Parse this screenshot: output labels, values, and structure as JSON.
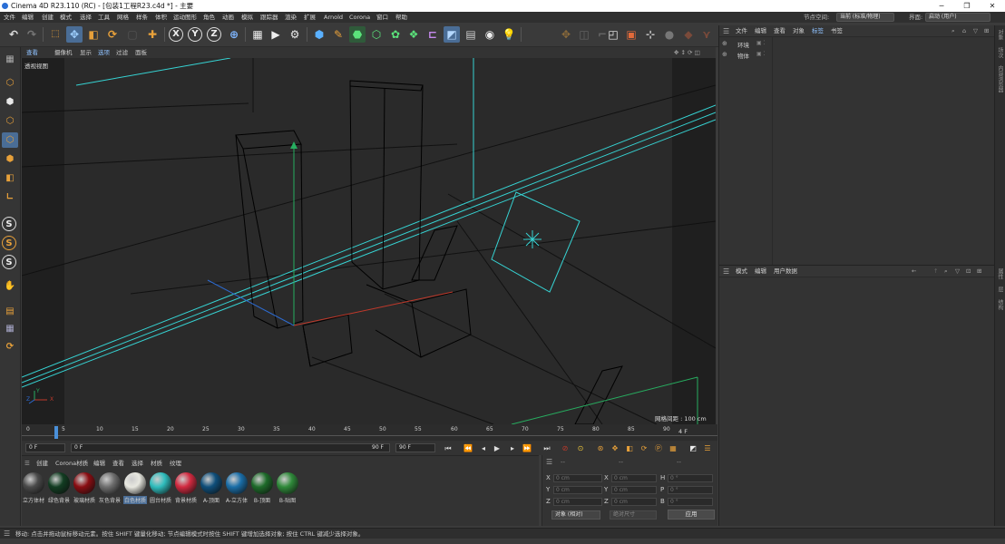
{
  "window": {
    "title": "Cinema 4D R23.110 (RC) - [包装1工程R23.c4d *] - 主要"
  },
  "menu": {
    "items": [
      "文件",
      "编辑",
      "创建",
      "模式",
      "选择",
      "工具",
      "网格",
      "样条",
      "体积",
      "运动图形",
      "角色",
      "动画",
      "模拟",
      "跟踪器",
      "渲染",
      "扩展",
      "Arnold",
      "Corona",
      "窗口",
      "帮助"
    ],
    "node_space_label": "节点空间:",
    "node_space_value": "当前 (标准/物理)",
    "layout_label": "界面:",
    "layout_value": "启动 (用户)"
  },
  "viewport": {
    "menu": [
      "查看",
      "摄像机",
      "显示",
      "选项",
      "过滤",
      "面板"
    ],
    "view_name": "透视视图",
    "grid_spacing": "网格间距 : 100 cm",
    "axis_labels": {
      "x": "X",
      "y": "Y",
      "z": "Z"
    }
  },
  "timeline": {
    "ticks": [
      "0",
      "5",
      "10",
      "15",
      "20",
      "25",
      "30",
      "35",
      "40",
      "45",
      "50",
      "55",
      "60",
      "65",
      "70",
      "75",
      "80",
      "85",
      "90"
    ],
    "current_frame": "4 F",
    "start_field": "0 F",
    "current_field": "0 F",
    "end_field": "90 F",
    "end_field2": "90 F"
  },
  "materials": {
    "menu": [
      "创建",
      "Corona材质",
      "编辑",
      "查看",
      "选择",
      "材质",
      "纹理"
    ],
    "items": [
      {
        "label": "立方体材",
        "color": "#4a4a4a"
      },
      {
        "label": "绿色背景",
        "color": "#123d22"
      },
      {
        "label": "玻璃材质",
        "color": "#8a0d12"
      },
      {
        "label": "灰色背景",
        "color": "#6e6e6e"
      },
      {
        "label": "白色材质",
        "color": "#e8e8e0"
      },
      {
        "label": "圆台材质",
        "color": "#2fbdbd"
      },
      {
        "label": "背景材质",
        "color": "#d22a40"
      },
      {
        "label": "A-顶面",
        "color": "#0e4e7a"
      },
      {
        "label": "A-立方体",
        "color": "#1a6ea8"
      },
      {
        "label": "B-顶面",
        "color": "#1e6b2a"
      },
      {
        "label": "B-贴图",
        "color": "#2f8a3a"
      }
    ]
  },
  "coordinates": {
    "header": [
      "--",
      "--",
      "--"
    ],
    "rows": [
      {
        "a": "X",
        "av": "0 cm",
        "b": "X",
        "bv": "0 cm",
        "c": "H",
        "cv": "0 °"
      },
      {
        "a": "Y",
        "av": "0 cm",
        "b": "Y",
        "bv": "0 cm",
        "c": "P",
        "cv": "0 °"
      },
      {
        "a": "Z",
        "av": "0 cm",
        "b": "Z",
        "bv": "0 cm",
        "c": "B",
        "cv": "0 °"
      }
    ],
    "mode_select": "对象 (相对)",
    "size_select": "绝对尺寸",
    "apply": "应用"
  },
  "objects": {
    "menu": [
      "文件",
      "编辑",
      "查看",
      "对象",
      "标签",
      "书签"
    ],
    "tree": [
      "环境",
      "物体"
    ]
  },
  "attributes": {
    "menu": [
      "模式",
      "编辑",
      "用户数据"
    ]
  },
  "right_tabs": [
    "对象",
    "场次",
    "内容浏览器",
    "属性",
    "层",
    "结构"
  ],
  "status": "移动: 点击并拖动鼠标移动元素。按住 SHIFT 键量化移动; 节点编辑模式时按住 SHIFT 键增加选择对象; 按住 CTRL 键减少选择对象。",
  "colors": {
    "accent": "#4a90d9",
    "light": "#36d3d3",
    "axis_x": "#c0392b",
    "axis_y": "#27ae60",
    "axis_z": "#2d6bd1"
  }
}
